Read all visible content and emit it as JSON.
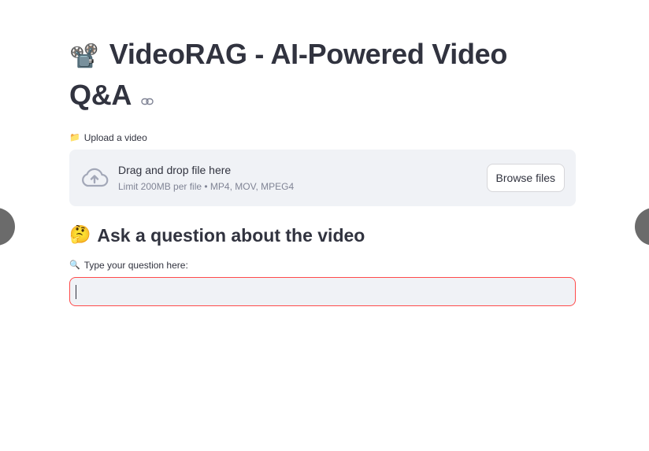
{
  "page": {
    "title_emoji": "📽️",
    "title": "VideoRAG - AI-Powered Video Q&A"
  },
  "uploader": {
    "label_emoji": "📁",
    "label": "Upload a video",
    "drop_text": "Drag and drop file here",
    "limit_text": "Limit 200MB per file • MP4, MOV, MPEG4",
    "browse_label": "Browse files",
    "icon": "cloud-upload-icon"
  },
  "question": {
    "header_emoji": "🤔",
    "header": "Ask a question about the video",
    "label_emoji": "🔍",
    "label": "Type your question here:",
    "value": ""
  },
  "colors": {
    "text": "#31333f",
    "muted": "#808495",
    "panel": "#f0f2f6",
    "focus_border": "#ff4b4b"
  }
}
